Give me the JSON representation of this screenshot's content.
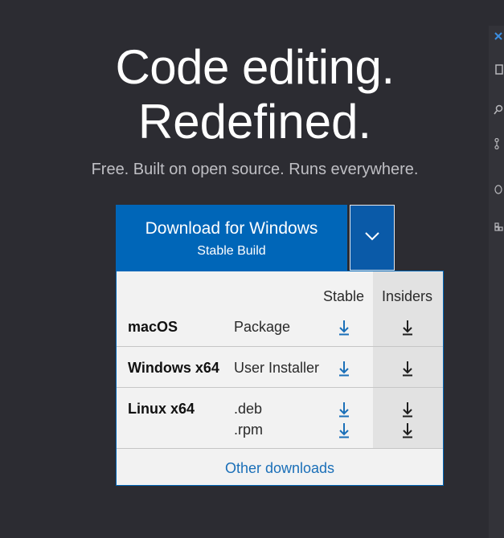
{
  "hero": {
    "line1": "Code editing.",
    "line2": "Redefined.",
    "tagline": "Free. Built on open source. Runs everywhere."
  },
  "download_button": {
    "label": "Download for Windows",
    "sublabel": "Stable Build"
  },
  "dropdown": {
    "headers": {
      "stable": "Stable",
      "insiders": "Insiders"
    },
    "rows": [
      {
        "os": "macOS",
        "packages": [
          "Package"
        ]
      },
      {
        "os": "Windows x64",
        "packages": [
          "User Installer"
        ]
      },
      {
        "os": "Linux x64",
        "packages": [
          ".deb",
          ".rpm"
        ]
      }
    ],
    "other_downloads": "Other downloads"
  },
  "colors": {
    "background": "#2c2c32",
    "accent": "#0066b8",
    "stable_icon": "#1a6fb8",
    "insiders_icon": "#1e1e1e"
  },
  "icons": [
    "chevron-down-icon",
    "download-arrow-icon",
    "close-icon",
    "files-icon",
    "search-icon",
    "source-control-icon",
    "debug-icon",
    "extensions-icon"
  ]
}
